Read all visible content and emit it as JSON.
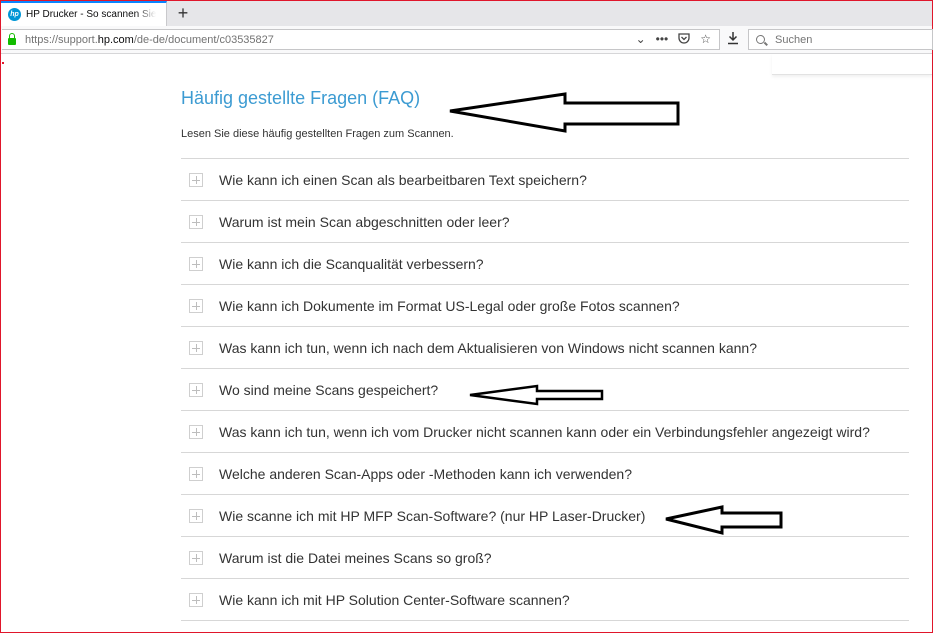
{
  "browser": {
    "tab_title": "HP Drucker - So scannen Sie (W",
    "new_tab": "+",
    "url_prefix": "https://support.",
    "url_domain": "hp.com",
    "url_path": "/de-de/document/c03535827",
    "search_placeholder": "Suchen",
    "menu_dots": "•••"
  },
  "faq": {
    "title": "Häufig gestellte Fragen (FAQ)",
    "subtitle": "Lesen Sie diese häufig gestellten Fragen zum Scannen.",
    "items": [
      "Wie kann ich einen Scan als bearbeitbaren Text speichern?",
      "Warum ist mein Scan abgeschnitten oder leer?",
      "Wie kann ich die Scanqualität verbessern?",
      "Wie kann ich Dokumente im Format US-Legal oder große Fotos scannen?",
      "Was kann ich tun, wenn ich nach dem Aktualisieren von Windows nicht scannen kann?",
      "Wo sind meine Scans gespeichert?",
      "Was kann ich tun, wenn ich vom Drucker nicht scannen kann oder ein Verbindungsfehler angezeigt wird?",
      "Welche anderen Scan-Apps oder -Methoden kann ich verwenden?",
      "Wie scanne ich mit HP MFP Scan-Software? (nur HP Laser-Drucker)",
      "Warum ist die Datei meines Scans so groß?",
      "Wie kann ich mit HP Solution Center-Software scannen?"
    ]
  },
  "colors": {
    "accent": "#3c9bd2",
    "frame": "#e0162b"
  }
}
